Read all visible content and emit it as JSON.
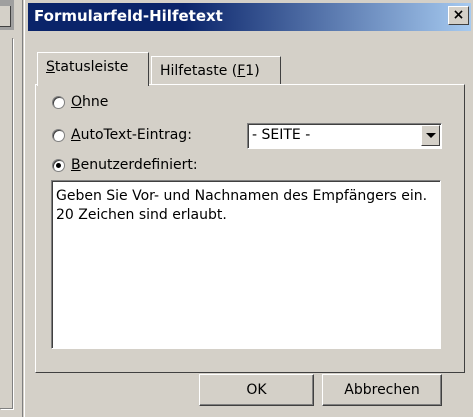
{
  "dialog": {
    "title": "Formularfeld-Hilfetext",
    "close_label": "×"
  },
  "tabs": [
    {
      "prefix": "",
      "mnemonic": "S",
      "rest": "tatusleiste",
      "active": true
    },
    {
      "prefix": "Hilfetaste (",
      "mnemonic": "F",
      "rest": "1)",
      "active": false
    }
  ],
  "options": {
    "none": {
      "prefix": "",
      "mnemonic": "O",
      "rest": "hne",
      "checked": false
    },
    "autotext": {
      "prefix": "",
      "mnemonic": "A",
      "rest": "utoText-Eintrag:",
      "checked": false
    },
    "custom": {
      "prefix": "",
      "mnemonic": "B",
      "rest": "enutzerdefiniert:",
      "checked": true
    }
  },
  "autotext_select": {
    "value": "- SEITE -"
  },
  "custom_text": "Geben Sie Vor- und Nachnamen des Empfängers ein.\n20 Zeichen sind erlaubt.",
  "buttons": {
    "ok": "OK",
    "cancel": "Abbrechen"
  }
}
